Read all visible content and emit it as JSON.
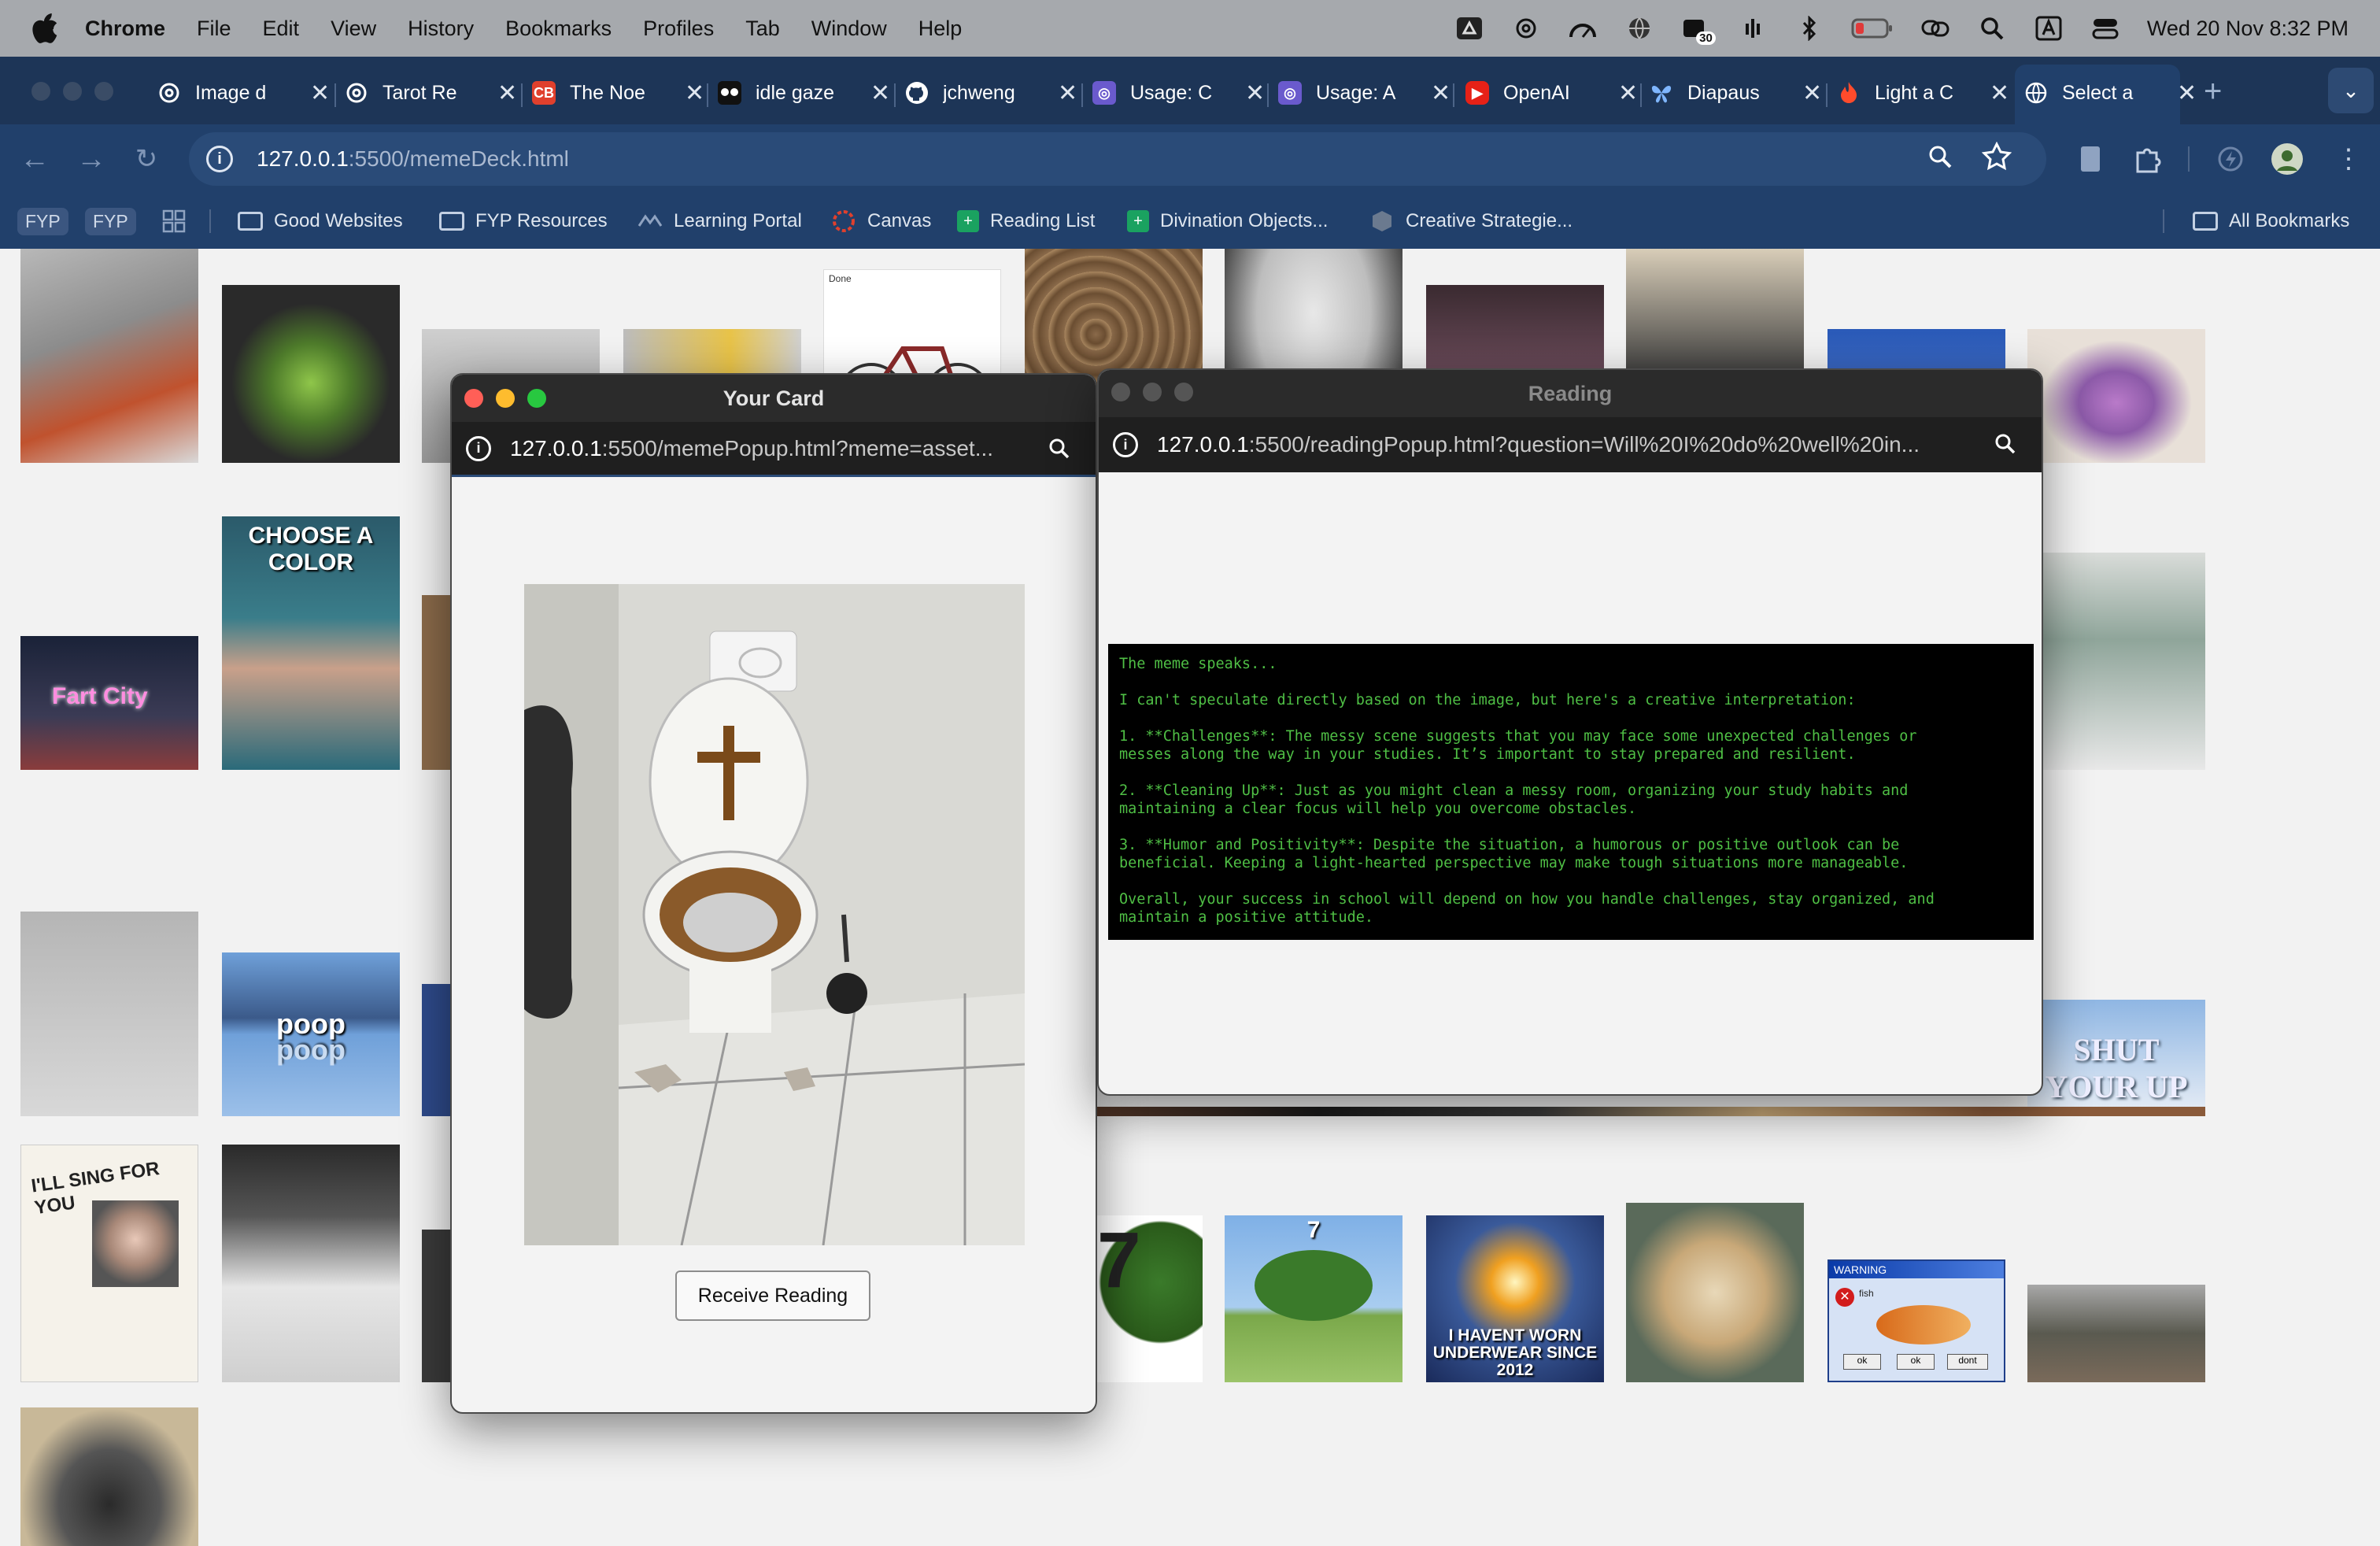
{
  "menubar": {
    "app": "Chrome",
    "items": [
      "File",
      "Edit",
      "View",
      "History",
      "Bookmarks",
      "Profiles",
      "Tab",
      "Window",
      "Help"
    ],
    "clock": "Wed 20 Nov  8:32 PM",
    "badge_count": "30"
  },
  "tabs": [
    {
      "title": "Image d",
      "favicon": "openai-icon"
    },
    {
      "title": "Tarot Re",
      "favicon": "openai-icon"
    },
    {
      "title": "The Noe",
      "favicon": "cb-icon"
    },
    {
      "title": "idle gaze",
      "favicon": "face-icon"
    },
    {
      "title": "jchweng",
      "favicon": "github-icon"
    },
    {
      "title": "Usage: C",
      "favicon": "usage-icon"
    },
    {
      "title": "Usage: A",
      "favicon": "usage-icon"
    },
    {
      "title": "OpenAI",
      "favicon": "youtube-icon"
    },
    {
      "title": "Diapaus",
      "favicon": "butterfly-icon"
    },
    {
      "title": "Light a C",
      "favicon": "fire-icon"
    },
    {
      "title": "Select a",
      "favicon": "globe-icon",
      "active": true
    }
  ],
  "toolbar": {
    "url_host": "127.0.0.1",
    "url_rest": ":5500/memeDeck.html"
  },
  "bookmarks": {
    "chip1": "FYP",
    "chip2": "FYP",
    "items": [
      "Good Websites",
      "FYP Resources",
      "Learning Portal",
      "Canvas",
      "Reading List",
      "Divination Objects...",
      "Creative Strategie..."
    ],
    "all": "All Bookmarks"
  },
  "memes": {
    "choose_color": "CHOOSE A COLOR",
    "fart_city": "Fart City",
    "poop": "poop",
    "boob": "boob",
    "done": "Done",
    "sing": "I'LL SING FOR YOU",
    "seven": "7",
    "underwear": "I HAVENT WORN UNDERWEAR SINCE 2012",
    "shut_up": "SHUT YOUR UP",
    "warning": "WARNING",
    "fish": "fish",
    "ok1": "ok",
    "ok2": "ok",
    "dont": "dont"
  },
  "card_popup": {
    "title": "Your Card",
    "url_host": "127.0.0.1",
    "url_rest": ":5500/memePopup.html?meme=asset...",
    "button": "Receive Reading"
  },
  "reading_popup": {
    "title": "Reading",
    "url_host": "127.0.0.1",
    "url_rest": ":5500/readingPopup.html?question=Will%20I%20do%20well%20in...",
    "text": "The meme speaks...\n\nI can't speculate directly based on the image, but here's a creative interpretation:\n\n1. **Challenges**: The messy scene suggests that you may face some unexpected challenges or\nmesses along the way in your studies. It’s important to stay prepared and resilient.\n\n2. **Cleaning Up**: Just as you might clean a messy room, organizing your study habits and\nmaintaining a clear focus will help you overcome obstacles.\n\n3. **Humor and Positivity**: Despite the situation, a humorous or positive outlook can be\nbeneficial. Keeping a light-hearted perspective may make tough situations more manageable.\n\nOverall, your success in school will depend on how you handle challenges, stay organized, and\nmaintain a positive attitude."
  },
  "colors": {
    "chrome_dark": "#1d3557",
    "chrome_toolbar": "#21406b",
    "terminal_green": "#4fbf45"
  }
}
